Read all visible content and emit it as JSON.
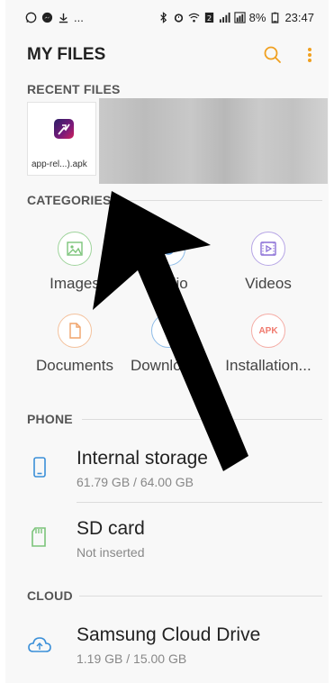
{
  "status_bar": {
    "left_icons": [
      "whatsapp-icon",
      "messenger-icon",
      "download-icon"
    ],
    "left_more": "...",
    "battery": "8%",
    "time": "23:47"
  },
  "header": {
    "title": "MY FILES"
  },
  "recent": {
    "label": "RECENT FILES",
    "file_name": "app-rel...).apk"
  },
  "categories": {
    "label": "CATEGORIES",
    "items": [
      {
        "label": "Images",
        "color": "#7cc47a"
      },
      {
        "label": "Audio",
        "color": "#5a9be0"
      },
      {
        "label": "Videos",
        "color": "#8a6fd6"
      },
      {
        "label": "Documents",
        "color": "#f0a36a"
      },
      {
        "label": "Downloads",
        "color": "#5a9be0"
      },
      {
        "label": "Installation...",
        "color": "#f07a6e",
        "badge": "APK"
      }
    ]
  },
  "phone": {
    "label": "PHONE",
    "internal": {
      "title": "Internal storage",
      "sub": "61.79 GB / 64.00 GB"
    },
    "sdcard": {
      "title": "SD card",
      "sub": "Not inserted"
    }
  },
  "cloud": {
    "label": "CLOUD",
    "samsung": {
      "title": "Samsung Cloud Drive",
      "sub": "1.19 GB / 15.00 GB"
    }
  },
  "colors": {
    "accent": "#f0a020",
    "blue": "#3a8fd8",
    "green": "#7cc47a"
  }
}
